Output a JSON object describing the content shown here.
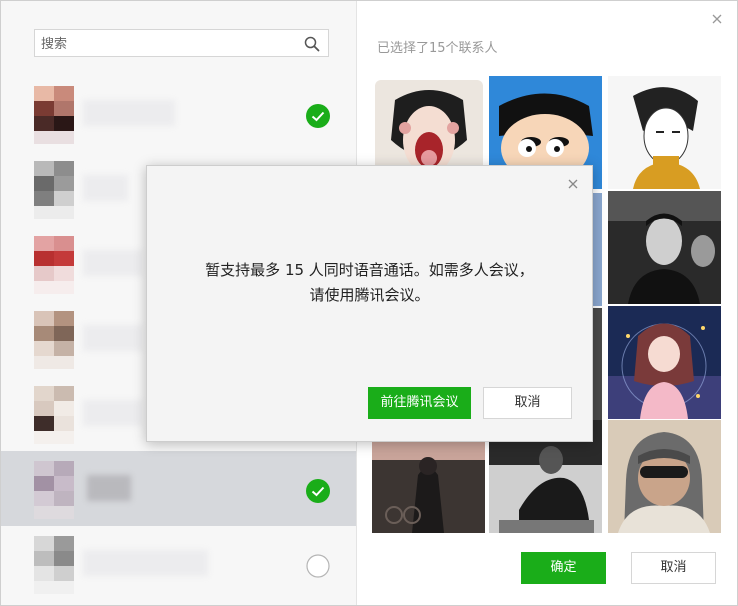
{
  "search": {
    "placeholder": "搜索"
  },
  "right_panel": {
    "selected_label": "已选择了15个联系人"
  },
  "footer": {
    "confirm_label": "确定",
    "cancel_label": "取消"
  },
  "dialog": {
    "message_line1": "暂支持最多 15 人同时语音通话。如需多人会议，",
    "message_line2": "请使用腾讯会议。",
    "primary_label": "前往腾讯会议",
    "cancel_label": "取消"
  },
  "contacts": [
    {
      "state": "checked"
    },
    {
      "state": "unchecked"
    },
    {
      "state": "unchecked"
    },
    {
      "state": "unchecked"
    },
    {
      "state": "unchecked"
    },
    {
      "state": "checked"
    },
    {
      "state": "unchecked"
    }
  ],
  "icons": {
    "search": "search-icon",
    "close": "close-icon",
    "check": "check-circle-icon",
    "empty": "empty-circle-icon"
  },
  "colors": {
    "accent": "#1aad19",
    "highlight": "#d6d8dc"
  }
}
